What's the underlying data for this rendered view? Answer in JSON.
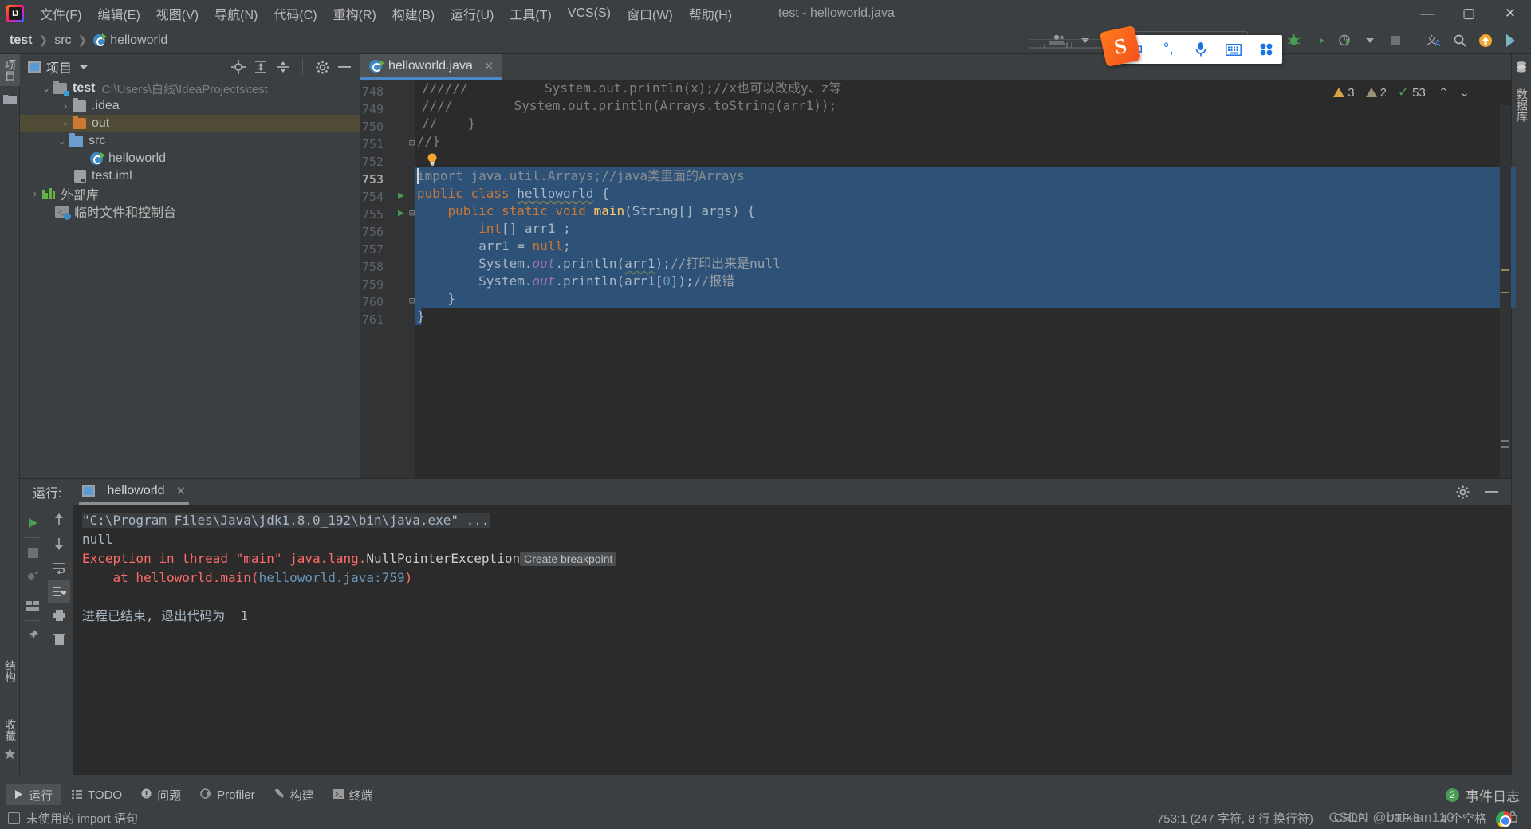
{
  "window": {
    "title": "test - helloworld.java",
    "minimize": "—",
    "maximize": "▢",
    "close": "✕"
  },
  "menu": {
    "items": [
      {
        "label": "文件(F)"
      },
      {
        "label": "编辑(E)"
      },
      {
        "label": "视图(V)"
      },
      {
        "label": "导航(N)"
      },
      {
        "label": "代码(C)"
      },
      {
        "label": "重构(R)"
      },
      {
        "label": "构建(B)"
      },
      {
        "label": "运行(U)"
      },
      {
        "label": "工具(T)"
      },
      {
        "label": "VCS(S)"
      },
      {
        "label": "窗口(W)"
      },
      {
        "label": "帮助(H)"
      }
    ]
  },
  "breadcrumb": {
    "project": "test",
    "folder": "src",
    "file": "helloworld"
  },
  "toolbar": {
    "run_config": "",
    "run": "run-button",
    "debug": "debug-button",
    "coverage": "coverage-button",
    "profile": "profile-button",
    "stop": "stop-button",
    "translate": "translate-button",
    "search": "search-button",
    "update": "update-button",
    "ide_feature": "feature-button"
  },
  "left_strip": {
    "project_tab": "项目",
    "structure_tab": "结构",
    "bookmarks_tab": "收藏"
  },
  "right_strip": {
    "database_tab": "数据库"
  },
  "project_panel": {
    "title": "项目",
    "tree": [
      {
        "indent": 0,
        "arrow": "⌄",
        "icon": "module-folder",
        "label": "test",
        "path": "C:\\Users\\白线\\IdeaProjects\\test",
        "bold": true,
        "highlight": false
      },
      {
        "indent": 1,
        "arrow": "›",
        "icon": "folder-gray",
        "label": ".idea",
        "path": "",
        "bold": false,
        "highlight": false
      },
      {
        "indent": 1,
        "arrow": "›",
        "icon": "folder-orange",
        "label": "out",
        "path": "",
        "bold": false,
        "highlight": true
      },
      {
        "indent": 1,
        "arrow": "⌄",
        "icon": "folder-blue",
        "label": "src",
        "path": "",
        "bold": false,
        "highlight": false
      },
      {
        "indent": 2,
        "arrow": "",
        "icon": "java-class",
        "label": "helloworld",
        "path": "",
        "bold": false,
        "highlight": false
      },
      {
        "indent": 1,
        "arrow": "",
        "icon": "iml-file",
        "label": "test.iml",
        "path": "",
        "bold": false,
        "highlight": false
      },
      {
        "indent": 0,
        "arrow": "›",
        "icon": "library",
        "label": "外部库",
        "path": "",
        "bold": false,
        "highlight": false
      },
      {
        "indent": 0,
        "arrow": "",
        "icon": "scratches",
        "label": "临时文件和控制台",
        "path": "",
        "bold": false,
        "highlight": false
      }
    ]
  },
  "editor": {
    "tab_label": "helloworld.java",
    "tab_close": "✕",
    "inspections": {
      "warnings": "3",
      "weak_warnings": "2",
      "ok": "53",
      "up": "⌃",
      "down": "⌄"
    },
    "lines": [
      {
        "num": "748",
        "text": "//////          System.out.println(x);//x也可以改成y、z等"
      },
      {
        "num": "749",
        "text": "////        System.out.println(Arrays.toString(arr1));"
      },
      {
        "num": "750",
        "text": "//    }"
      },
      {
        "num": "751",
        "text": "//}"
      },
      {
        "num": "752",
        "text": ""
      },
      {
        "num": "753",
        "text": "import java.util.Arrays;//java类里面的Arrays"
      },
      {
        "num": "754",
        "text": "public class helloworld {"
      },
      {
        "num": "755",
        "text": "    public static void main(String[] args) {"
      },
      {
        "num": "756",
        "text": "        int[] arr1 ;"
      },
      {
        "num": "757",
        "text": "        arr1 = null;"
      },
      {
        "num": "758",
        "text": "        System.out.println(arr1);//打印出来是null"
      },
      {
        "num": "759",
        "text": "        System.out.println(arr1[0]);//报错"
      },
      {
        "num": "760",
        "text": "    }"
      },
      {
        "num": "761",
        "text": "}"
      }
    ]
  },
  "run_panel": {
    "title": "运行:",
    "tab_label": "helloworld",
    "tab_close": "✕",
    "settings_icon": "gear-icon",
    "hide_icon": "minimize-icon",
    "console": [
      {
        "type": "cmd",
        "text": "\"C:\\Program Files\\Java\\jdk1.8.0_192\\bin\\java.exe\" ..."
      },
      {
        "type": "out",
        "text": "null"
      },
      {
        "type": "err",
        "text": "Exception in thread \"main\" java.lang.",
        "link": "NullPointerException",
        "badge": "Create breakpoint"
      },
      {
        "type": "trace",
        "prefix": "    at helloworld.main(",
        "link": "helloworld.java:759",
        "suffix": ")"
      },
      {
        "type": "blank",
        "text": ""
      },
      {
        "type": "out",
        "text": "进程已结束, 退出代码为  1"
      }
    ]
  },
  "bottom_tabs": {
    "items": [
      {
        "label": "运行",
        "icon": "play-icon",
        "selected": true
      },
      {
        "label": "TODO",
        "icon": "todo-icon",
        "selected": false
      },
      {
        "label": "问题",
        "icon": "problems-icon",
        "selected": false
      },
      {
        "label": "Profiler",
        "icon": "profiler-icon",
        "selected": false
      },
      {
        "label": "构建",
        "icon": "build-icon",
        "selected": false
      },
      {
        "label": "终端",
        "icon": "terminal-icon",
        "selected": false
      }
    ],
    "event_log": {
      "count": "2",
      "label": "事件日志"
    }
  },
  "status_bar": {
    "message": "未使用的 import 语句",
    "caret": "753:1 (247 字符, 8 行 换行符)",
    "line_sep": "CRLF",
    "encoding": "UTF-8",
    "indent": "4 个空格",
    "watermark": "CSDN @baixian110"
  },
  "ime": {
    "logo": "S",
    "mode": "中",
    "punct": "°,",
    "voice": "mic-icon",
    "keyboard": "keyboard-icon",
    "apps": "apps-icon"
  }
}
